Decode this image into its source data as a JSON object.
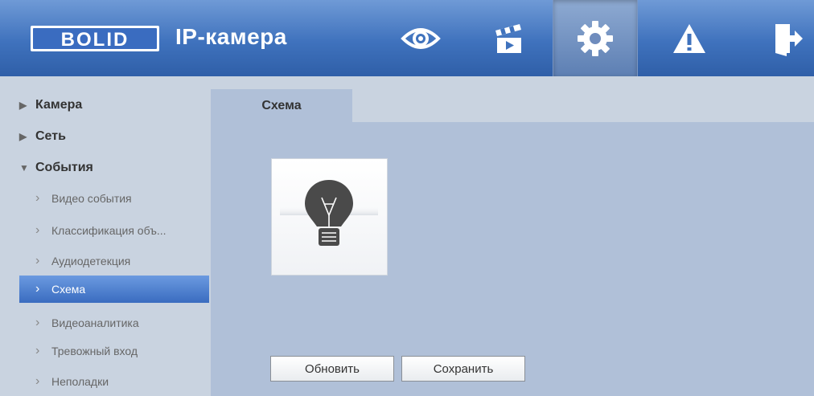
{
  "header": {
    "logo_text": "BOLID",
    "title": "IP-камера",
    "nav": [
      {
        "name": "live-view",
        "icon": "eye-icon"
      },
      {
        "name": "playback",
        "icon": "clapperboard-icon"
      },
      {
        "name": "settings",
        "icon": "gear-icon",
        "active": true
      },
      {
        "name": "alarm",
        "icon": "warning-icon"
      },
      {
        "name": "logout",
        "icon": "exit-icon"
      }
    ]
  },
  "sidebar": {
    "items": [
      {
        "label": "Камера",
        "level": 0,
        "expanded": false
      },
      {
        "label": "Сеть",
        "level": 0,
        "expanded": false
      },
      {
        "label": "События",
        "level": 0,
        "expanded": true
      },
      {
        "label": "Видео события",
        "level": 1
      },
      {
        "label": "Классификация объ...",
        "level": 1
      },
      {
        "label": "Аудиодетекция",
        "level": 1
      },
      {
        "label": "Схема",
        "level": 1,
        "selected": true
      },
      {
        "label": "Видеоаналитика",
        "level": 1
      },
      {
        "label": "Тревожный вход",
        "level": 1
      },
      {
        "label": "Неполадки",
        "level": 1
      }
    ]
  },
  "main": {
    "tab_label": "Схема",
    "scheme_icon": "lightbulb-icon",
    "refresh_label": "Обновить",
    "save_label": "Сохранить"
  },
  "colors": {
    "header_blue": "#3f72bd",
    "selected_blue": "#3a6cc0",
    "panel_bg": "#b0c0d8",
    "sidebar_bg": "#c9d3e0"
  }
}
